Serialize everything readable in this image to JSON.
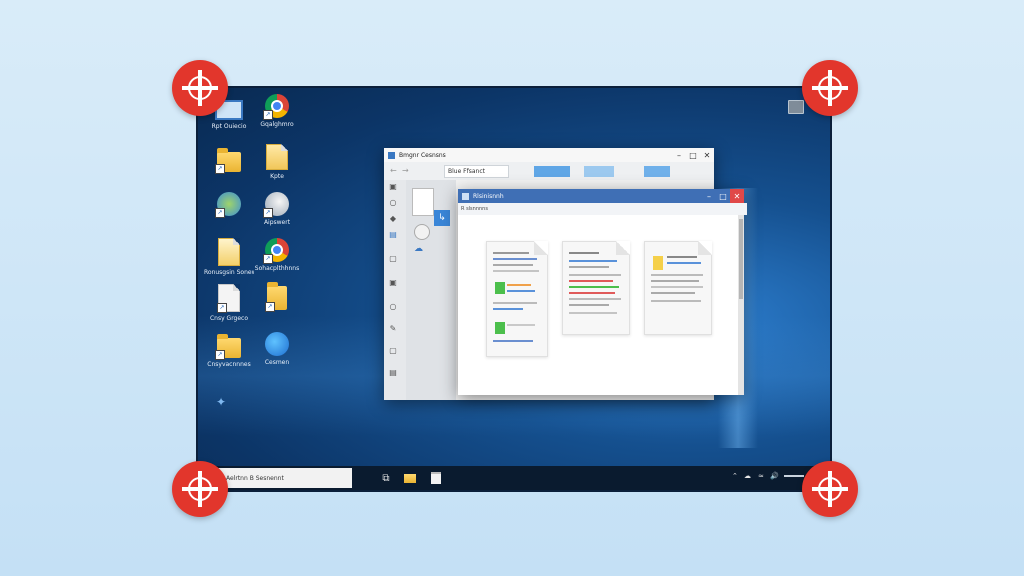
{
  "desktop_icons": [
    {
      "label": "Rpt Ouiecio",
      "icon": "monitor-icon"
    },
    {
      "label": "Gqalghmro",
      "icon": "chrome-icon"
    },
    {
      "label": "",
      "icon": "folder-icon"
    },
    {
      "label": "Kpte",
      "icon": "document-icon"
    },
    {
      "label": "",
      "icon": "settings-shortcut-icon"
    },
    {
      "label": "Aipswert",
      "icon": "app-shortcut-icon"
    },
    {
      "label": "Ronusgsin Sonew",
      "icon": "document-icon"
    },
    {
      "label": "Sohacplthhnns",
      "icon": "chrome-icon"
    },
    {
      "label": "Cnsy Grgeco",
      "icon": "document-icon"
    },
    {
      "label": "",
      "icon": "folder-icon"
    },
    {
      "label": "Cnsyvacnnnes",
      "icon": "folder-icon"
    },
    {
      "label": "Cesmen",
      "icon": "remote-desktop-icon"
    },
    {
      "label": "",
      "icon": "pin-icon"
    }
  ],
  "explorer_window": {
    "title": "Bmgnr Cesnsns",
    "address": "Blue Ffsanct",
    "controls": {
      "minimize": "–",
      "maximize": "□",
      "close": "✕"
    }
  },
  "front_window": {
    "title": "Rlsinisnnh",
    "toolbar_label": "R slsnnnns",
    "controls": {
      "minimize": "–",
      "maximize": "□",
      "close": "✕"
    }
  },
  "taskbar": {
    "search_text": "Aelrtnn B Sesnennt",
    "tray_items": [
      "⌃",
      "☁",
      "≈",
      "🔊"
    ]
  },
  "colors": {
    "handle": "#e2362c",
    "desktop": "#0c3567",
    "taskbar": "#0a1b2f",
    "window_accent": "#3f6fb5"
  }
}
